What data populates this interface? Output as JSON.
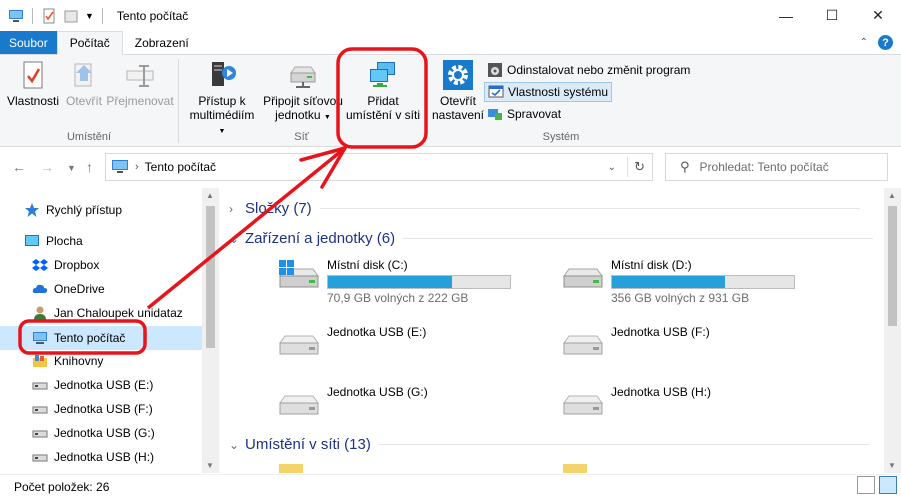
{
  "window": {
    "title": "Tento počítač",
    "controls": [
      "—",
      "☐",
      "✕"
    ]
  },
  "ribbon_tabs": {
    "file": "Soubor",
    "computer": "Počítač",
    "view": "Zobrazení"
  },
  "ribbon": {
    "location_group": {
      "label": "Umístění",
      "properties": "Vlastnosti",
      "open": "Otevřít",
      "rename": "Přejmenovat"
    },
    "network_group": {
      "label": "Síť",
      "media_line1": "Přístup k",
      "media_line2": "multimédiím",
      "map_line1": "Připojit síťovou",
      "map_line2": "jednotku",
      "add_line1": "Přidat",
      "add_line2": "umístění v síti"
    },
    "system_group": {
      "label": "Systém",
      "settings_line1": "Otevřít",
      "settings_line2": "nastavení",
      "uninstall": "Odinstalovat nebo změnit program",
      "sysprops": "Vlastnosti systému",
      "manage": "Spravovat"
    }
  },
  "address": {
    "path": "Tento počítač",
    "search_placeholder": "Prohledat: Tento počítač"
  },
  "nav": {
    "items": [
      {
        "label": "Rychlý přístup",
        "icon": "star-icon"
      },
      {
        "label": "Plocha",
        "icon": "desktop-icon"
      },
      {
        "label": "Dropbox",
        "icon": "dropbox-icon"
      },
      {
        "label": "OneDrive",
        "icon": "cloud-icon"
      },
      {
        "label": "Jan Chaloupek unidataz",
        "icon": "user-icon"
      },
      {
        "label": "Tento počítač",
        "icon": "computer-icon"
      },
      {
        "label": "Knihovny",
        "icon": "library-icon"
      },
      {
        "label": "Jednotka USB (E:)",
        "icon": "usb-drive-icon"
      },
      {
        "label": "Jednotka USB (F:)",
        "icon": "usb-drive-icon"
      },
      {
        "label": "Jednotka USB (G:)",
        "icon": "usb-drive-icon"
      },
      {
        "label": "Jednotka USB (H:)",
        "icon": "usb-drive-icon"
      }
    ]
  },
  "content": {
    "sections": {
      "folders": "Složky (7)",
      "devices": "Zařízení a jednotky (6)",
      "network": "Umístění v síti (13)"
    },
    "drives": [
      {
        "name": "Místní disk (C:)",
        "free": "70,9 GB volných z 222 GB",
        "used_fraction": 0.68
      },
      {
        "name": "Místní disk (D:)",
        "free": "356 GB volných z 931 GB",
        "used_fraction": 0.62
      },
      {
        "name": "Jednotka USB (E:)"
      },
      {
        "name": "Jednotka USB (F:)"
      },
      {
        "name": "Jednotka USB (G:)"
      },
      {
        "name": "Jednotka USB (H:)"
      }
    ]
  },
  "status": {
    "count": "Počet položek: 26"
  },
  "colors": {
    "accent": "#1979ca",
    "annotation": "#e8141c",
    "bar_fill": "#26a0da"
  }
}
